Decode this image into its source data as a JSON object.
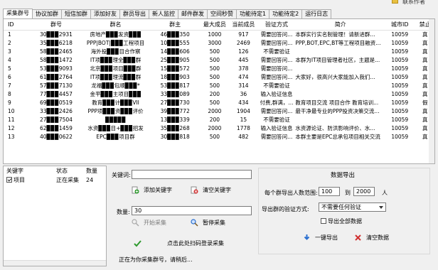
{
  "header": {
    "contact_label": "联系作者"
  },
  "tabs": [
    "采集群号",
    "协议加群",
    "短信加群",
    "添加好友",
    "群员导出",
    "新人监控",
    "邮件群发",
    "空间秒赞",
    "功能待定1",
    "功能待定2",
    "运行日志"
  ],
  "grid": {
    "columns": [
      "ID",
      "群号",
      "群名",
      "群主",
      "最大成员",
      "当前成员",
      "验证方式",
      "简介",
      "城市ID",
      "禁止"
    ],
    "rows": [
      [
        "1",
        "30▉▉▉2931",
        "房地产▉▉▉发资▉▉▉",
        "46▉▉▉350",
        "1000",
        "917",
        "需要回答问...",
        "本群实行实名制管理！请新进群...",
        "10059",
        "真"
      ],
      [
        "2",
        "35▉▉▉6218",
        "PPP|BOT|▉▉▉工程项目",
        "10▉▉▉555",
        "3000",
        "2469",
        "需要回答问...",
        "PPP,BOT,EPC,BT等工程项目融资...",
        "10059",
        "真"
      ],
      [
        "3",
        "58▉▉▉2465",
        "海外投▉▉▉目合作察",
        "14▉▉▉606",
        "500",
        "126",
        "不需要验证",
        "",
        "10059",
        "真"
      ],
      [
        "4",
        "58▉▉▉1472",
        "IT项▉▉▉理全▉▉▉群",
        "25▉▉▉905",
        "500",
        "445",
        "需要回答问...",
        "本群为IT项目管理者社区，主题是...",
        "10059",
        "真"
      ],
      [
        "5",
        "53▉▉▉9093",
        "北京▉▉▉项目▉▉▉群",
        "15▉▉▉572",
        "500",
        "378",
        "需要回答问...",
        "",
        "10059",
        "真"
      ],
      [
        "6",
        "61▉▉▉2764",
        "IT项▉▉▉理流▉▉▉群",
        "18▉▉▉903",
        "500",
        "474",
        "需要回答问...",
        "大家好，很高兴大家能加入我们...",
        "10059",
        "真"
      ],
      [
        "7",
        "57▉▉▉7130",
        "龙福▉▉▉包顺▉▉▉*",
        "53▉▉▉817",
        "500",
        "314",
        "不需要验证",
        "",
        "10059",
        "真"
      ],
      [
        "8",
        "77▉▉▉4457",
        "金平▉▉▉主项目▉▉▉",
        "33▉▉▉089",
        "200",
        "36",
        "输入验证信息",
        "",
        "10059",
        "真"
      ],
      [
        "9",
        "69▉▉▉0519",
        "教育▉▉▉计▉▉▉VII",
        "27▉▉▉730",
        "500",
        "434",
        "付费,群满，...",
        "教育项目交流 项目合作 教育培训...",
        "10059",
        "假"
      ],
      [
        "10",
        "33▉▉▉2426",
        "PPP项▉▉▉资▉▉▉评价",
        "39▉▉▉772",
        "2000",
        "1904",
        "需要回答问...",
        "最干净最专业的PPP投资决策交流...",
        "10059",
        "真"
      ],
      [
        "11",
        "27▉▉▉7504",
        "▉▉▉▉▉",
        "13▉▉▉339",
        "200",
        "15",
        "不需要验证",
        "",
        "10059",
        "真"
      ],
      [
        "12",
        "62▉▉▉1459",
        "水资▉▉▉目+▉▉▉招发",
        "35▉▉▉268",
        "2000",
        "1778",
        "输入验证信息",
        "水资源论证、防洪影响评价、水...",
        "10059",
        "真"
      ],
      [
        "13",
        "40▉▉▉0622",
        "EPC▉▉▉项目群",
        "30▉▉▉818",
        "500",
        "482",
        "需要回答问...",
        "本群主要是EPC总承包项目相关交流",
        "10059",
        "真"
      ]
    ]
  },
  "keyword_list": {
    "columns": [
      "关键字",
      "状态",
      "数量"
    ],
    "rows": [
      {
        "keyword": "项目",
        "status": "正在采集",
        "count": "24",
        "checked": true
      }
    ]
  },
  "collect": {
    "keyword_label": "关键词:",
    "keyword_value": "",
    "add_keyword": "添加关键字",
    "clear_keyword": "清空关键字",
    "quantity_label": "数量:",
    "quantity_value": "30",
    "start": "开始采集",
    "pause": "暂停采集",
    "scan_login": "点击此处扫码登录采集",
    "status_text": "正在为你采集群号，请稍后..."
  },
  "export": {
    "title": "数据导出",
    "range_label": "每个群导出人数范围:",
    "range_from": "100",
    "range_to_label": "到",
    "range_to": "2000",
    "range_unit": "人",
    "verify_label": "导出群的验证方式:",
    "verify_value": "不需要任何验证",
    "export_all": "导出全部数据",
    "one_click": "一键导出",
    "clear": "清空数据"
  },
  "colors": {
    "green_icon": "#2e9a2e",
    "blue_icon": "#2a6fd0",
    "red_icon": "#d03030"
  }
}
